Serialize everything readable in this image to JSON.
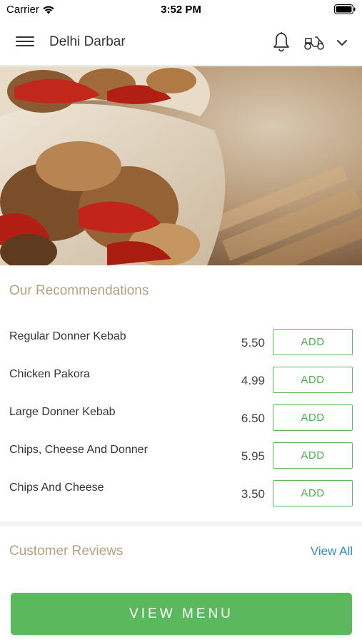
{
  "status_bar": {
    "carrier": "Carrier",
    "time": "3:52 PM",
    "icons": [
      "wifi-icon",
      "battery-icon"
    ]
  },
  "header": {
    "title": "Delhi Darbar",
    "icons": [
      "hamburger-menu-icon",
      "bell-icon",
      "delivery-scooter-icon",
      "chevron-down-icon"
    ]
  },
  "hero": {
    "image": "wrap-with-chicken-and-red-peppers"
  },
  "recommendations": {
    "title": "Our Recommendations",
    "items": [
      {
        "name": "Regular Donner Kebab",
        "price": "5.50",
        "action": "ADD"
      },
      {
        "name": "Chicken Pakora",
        "price": "4.99",
        "action": "ADD"
      },
      {
        "name": "Large Donner Kebab",
        "price": "6.50",
        "action": "ADD"
      },
      {
        "name": "Chips, Cheese And Donner",
        "price": "5.95",
        "action": "ADD"
      },
      {
        "name": "Chips And Cheese",
        "price": "3.50",
        "action": "ADD"
      }
    ]
  },
  "reviews": {
    "title": "Customer Reviews",
    "view_all": "View All"
  },
  "footer": {
    "view_menu": "VIEW MENU"
  },
  "colors": {
    "accent_green": "#5cb85c",
    "section_title": "#b3a27e",
    "link_blue": "#2e8fc6"
  }
}
